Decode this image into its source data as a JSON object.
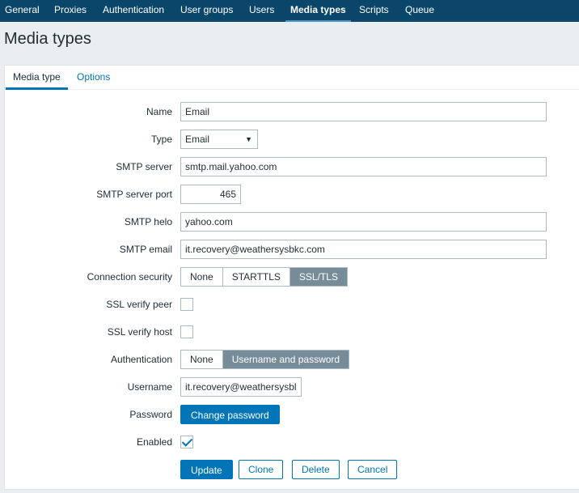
{
  "nav": {
    "items": [
      "General",
      "Proxies",
      "Authentication",
      "User groups",
      "Users",
      "Media types",
      "Scripts",
      "Queue"
    ],
    "active": "Media types"
  },
  "page": {
    "title": "Media types"
  },
  "tabs": {
    "media_type": "Media type",
    "options": "Options"
  },
  "form": {
    "name": {
      "label": "Name",
      "value": "Email"
    },
    "type": {
      "label": "Type",
      "value": "Email",
      "arrow": "▼"
    },
    "smtp_server": {
      "label": "SMTP server",
      "value": "smtp.mail.yahoo.com"
    },
    "smtp_port": {
      "label": "SMTP server port",
      "value": "465"
    },
    "smtp_helo": {
      "label": "SMTP helo",
      "value": "yahoo.com"
    },
    "smtp_email": {
      "label": "SMTP email",
      "value": "it.recovery@weathersysbkc.com"
    },
    "connection_security": {
      "label": "Connection security",
      "options": [
        "None",
        "STARTTLS",
        "SSL/TLS"
      ],
      "selected": "SSL/TLS"
    },
    "ssl_verify_peer": {
      "label": "SSL verify peer",
      "checked": false
    },
    "ssl_verify_host": {
      "label": "SSL verify host",
      "checked": false
    },
    "authentication": {
      "label": "Authentication",
      "options": [
        "None",
        "Username and password"
      ],
      "selected": "Username and password"
    },
    "username": {
      "label": "Username",
      "value": "it.recovery@weathersysbl"
    },
    "password": {
      "label": "Password",
      "button": "Change password"
    },
    "enabled": {
      "label": "Enabled",
      "checked": true
    }
  },
  "actions": {
    "update": "Update",
    "clone": "Clone",
    "delete": "Delete",
    "cancel": "Cancel"
  },
  "colors": {
    "nav_bg": "#0a466a",
    "primary": "#0275b8",
    "selected_segment": "#768d99",
    "page_bg": "#ebeef0"
  }
}
